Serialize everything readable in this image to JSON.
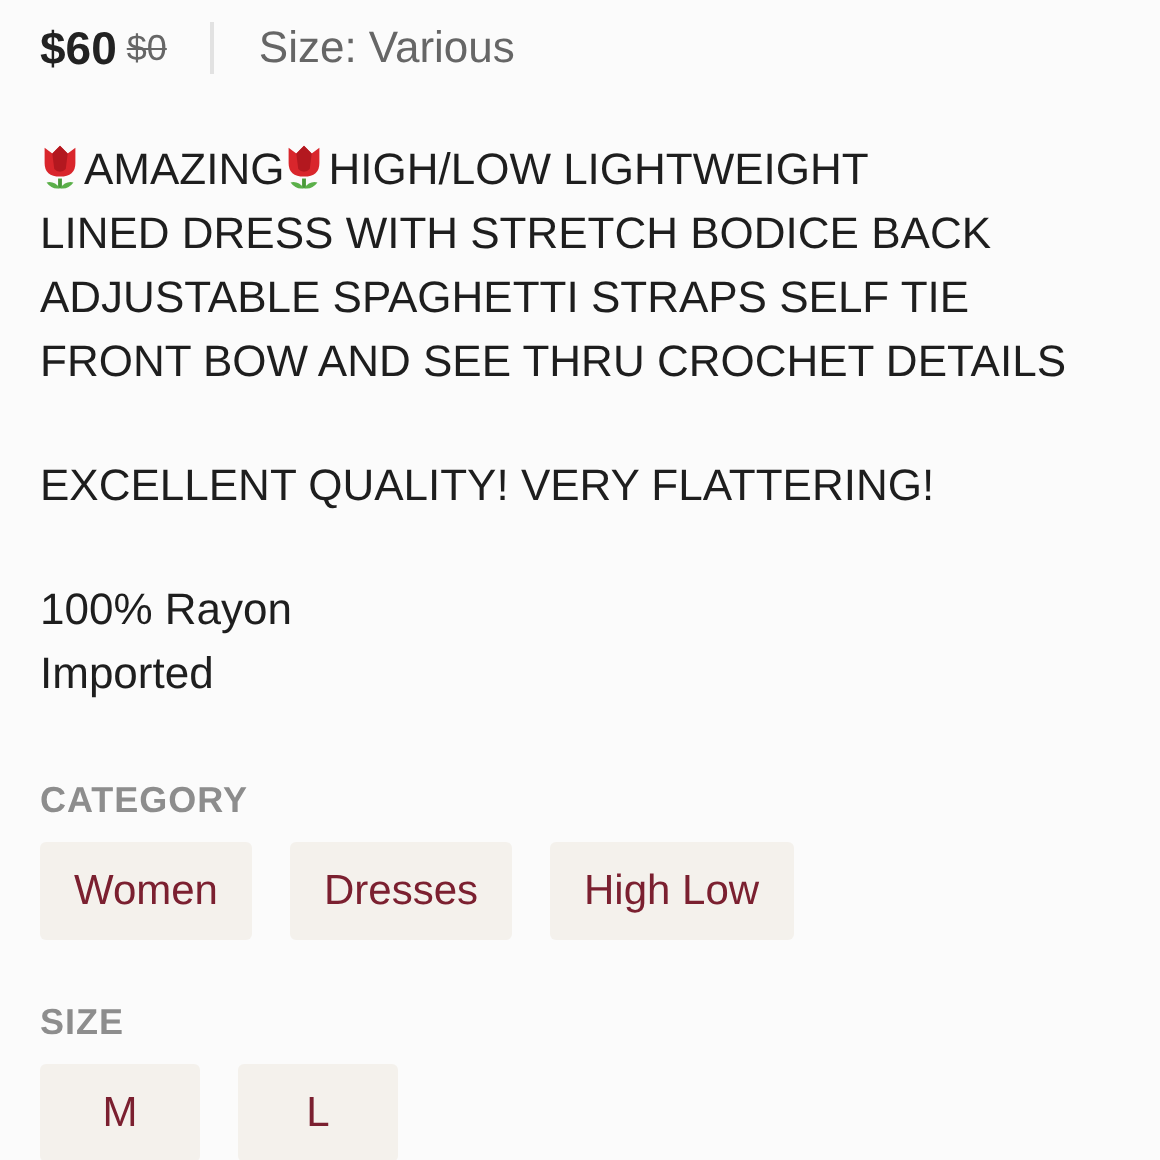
{
  "price": {
    "current": "$60",
    "original": "$0",
    "size": "Size: Various"
  },
  "description": [
    [
      [
        {
          "kind": "icon"
        },
        {
          "kind": "text",
          "text": "AMAZING"
        },
        {
          "kind": "icon"
        },
        {
          "kind": "text",
          "text": "HIGH/LOW LIGHTWEIGHT"
        }
      ],
      [
        {
          "kind": "text",
          "text": "LINED DRESS WITH STRETCH BODICE BACK"
        }
      ],
      [
        {
          "kind": "text",
          "text": "ADJUSTABLE SPAGHETTI STRAPS SELF TIE"
        }
      ],
      [
        {
          "kind": "text",
          "text": "FRONT BOW AND SEE THRU CROCHET DETAILS"
        }
      ]
    ],
    [
      [
        {
          "kind": "text",
          "text": "EXCELLENT QUALITY! VERY FLATTERING!"
        }
      ]
    ],
    [
      [
        {
          "kind": "text",
          "text": "100% Rayon"
        }
      ],
      [
        {
          "kind": "text",
          "text": "Imported"
        }
      ]
    ]
  ],
  "sections": [
    {
      "title": "CATEGORY",
      "tags": [
        "Women",
        "Dresses",
        "High Low"
      ]
    },
    {
      "title": "SIZE",
      "tags": [
        "M",
        "L"
      ]
    }
  ]
}
